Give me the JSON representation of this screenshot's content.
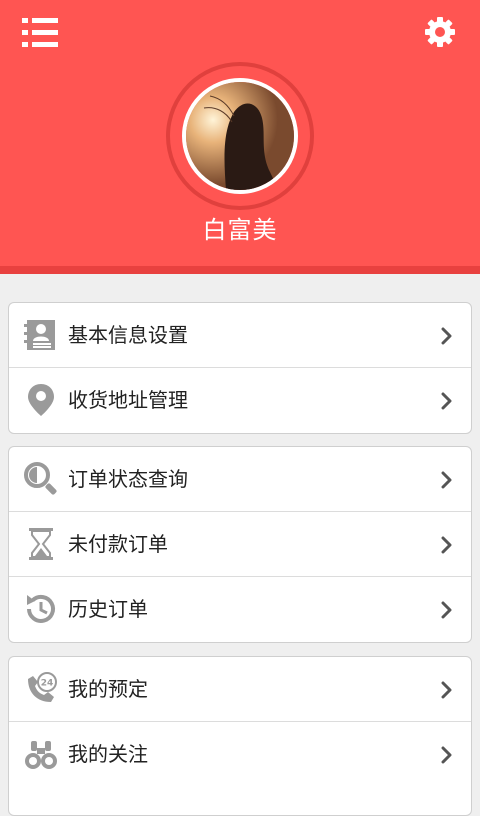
{
  "profile": {
    "user_name": "白富美"
  },
  "colors": {
    "header_bg": "#ff5552",
    "header_border": "#e8413f",
    "icon_gray": "#9a9a9a",
    "text": "#222222"
  },
  "groups": [
    {
      "items": [
        {
          "label": "基本信息设置",
          "icon": "contact-card-icon"
        },
        {
          "label": "收货地址管理",
          "icon": "location-pin-icon"
        }
      ]
    },
    {
      "items": [
        {
          "label": "订单状态查询",
          "icon": "magnifier-icon"
        },
        {
          "label": "未付款订单",
          "icon": "hourglass-icon"
        },
        {
          "label": "历史订单",
          "icon": "history-clock-icon"
        }
      ]
    },
    {
      "items": [
        {
          "label": "我的预定",
          "icon": "phone-24-icon"
        },
        {
          "label": "我的关注",
          "icon": "binoculars-icon"
        }
      ]
    }
  ]
}
